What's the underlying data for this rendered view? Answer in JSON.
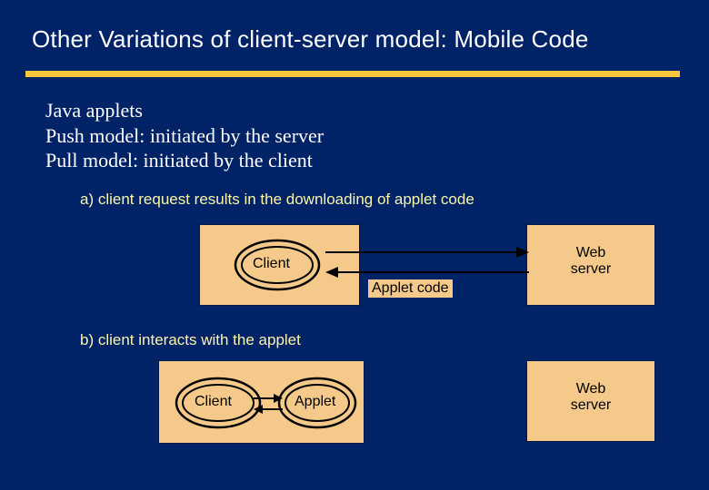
{
  "title": "Other Variations of client-server model: Mobile Code",
  "body": {
    "line1": "Java applets",
    "line2": "Push model: initiated by the server",
    "line3": "Pull model: initiated by the client"
  },
  "captions": {
    "a": "a) client request results in the downloading of applet code",
    "b": "b) client  interacts with the applet"
  },
  "labels": {
    "client": "Client",
    "web_server_l1": "Web",
    "web_server_l2": "server",
    "applet_code": "Applet code",
    "applet": "Applet"
  },
  "colors": {
    "background": "#002266",
    "rule": "#f9c73d",
    "panel": "#f4c98a",
    "caption": "#fbf6a8"
  }
}
